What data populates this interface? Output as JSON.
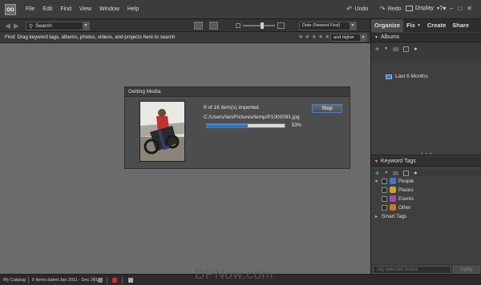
{
  "menu": {
    "logo": "OO",
    "items": [
      "File",
      "Edit",
      "Find",
      "View",
      "Window",
      "Help"
    ],
    "undo": "Undo",
    "redo": "Redo",
    "display": "Display"
  },
  "toolbar": {
    "search_placeholder": "Search",
    "sort_value": "Date (Newest First)"
  },
  "findbar": {
    "text": "Find: Drag keyword tags, albums, photos, videos, and projects here to search",
    "rating_filter": "and higher"
  },
  "dialog": {
    "title": "Getting Media",
    "status": "9 of 16 item(s) imported",
    "file_path": "C:/Users/Ian/Pictures/temp/P1000091.jpg",
    "progress_percent": 53,
    "progress_label": "53%",
    "stop_label": "Stop"
  },
  "panel": {
    "tabs": [
      "Organize",
      "Fix",
      "Create",
      "Share"
    ],
    "albums_header": "Albums",
    "albums": [
      "Last 6 Months"
    ],
    "tags_header": "Keyword Tags",
    "tags": [
      {
        "label": "People",
        "color": "#3b79c9"
      },
      {
        "label": "Places",
        "color": "#c8a430"
      },
      {
        "label": "Events",
        "color": "#9a4fb0"
      },
      {
        "label": "Other",
        "color": "#c8782a"
      }
    ],
    "smart_tags": "Smart Tags",
    "tag_input_placeholder": "Tag selected media",
    "apply_label": "Apply"
  },
  "statusbar": {
    "catalog": "My Catalog",
    "items": "0 items dated Jan 2011 - Dec 2011"
  },
  "watermark": "DPNow.com",
  "colors": {
    "accent": "#4c7fc9",
    "progress": "#2f74c4",
    "add_green": "#4fc94f"
  }
}
